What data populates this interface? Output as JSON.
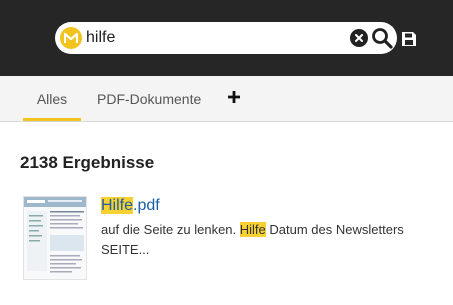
{
  "search": {
    "query": "hilfe"
  },
  "icons": {
    "logo": "logo-icon",
    "clear": "clear-icon",
    "search": "search-icon",
    "save": "save-icon",
    "add": "plus-icon"
  },
  "tabs": [
    {
      "label": "Alles",
      "active": true
    },
    {
      "label": "PDF-Dokumente",
      "active": false
    }
  ],
  "results": {
    "count_label": "2138 Ergebnisse",
    "items": [
      {
        "title_highlight": "Hilfe",
        "title_rest": ".pdf",
        "snippet_before": "auf die Seite zu lenken. ",
        "snippet_highlight": "Hilfe",
        "snippet_after": " Datum des Newsletters SEITE..."
      }
    ]
  },
  "colors": {
    "topbar": "#262626",
    "accent": "#f2c31c",
    "highlight": "#f7d131",
    "link": "#1a5ea8"
  }
}
